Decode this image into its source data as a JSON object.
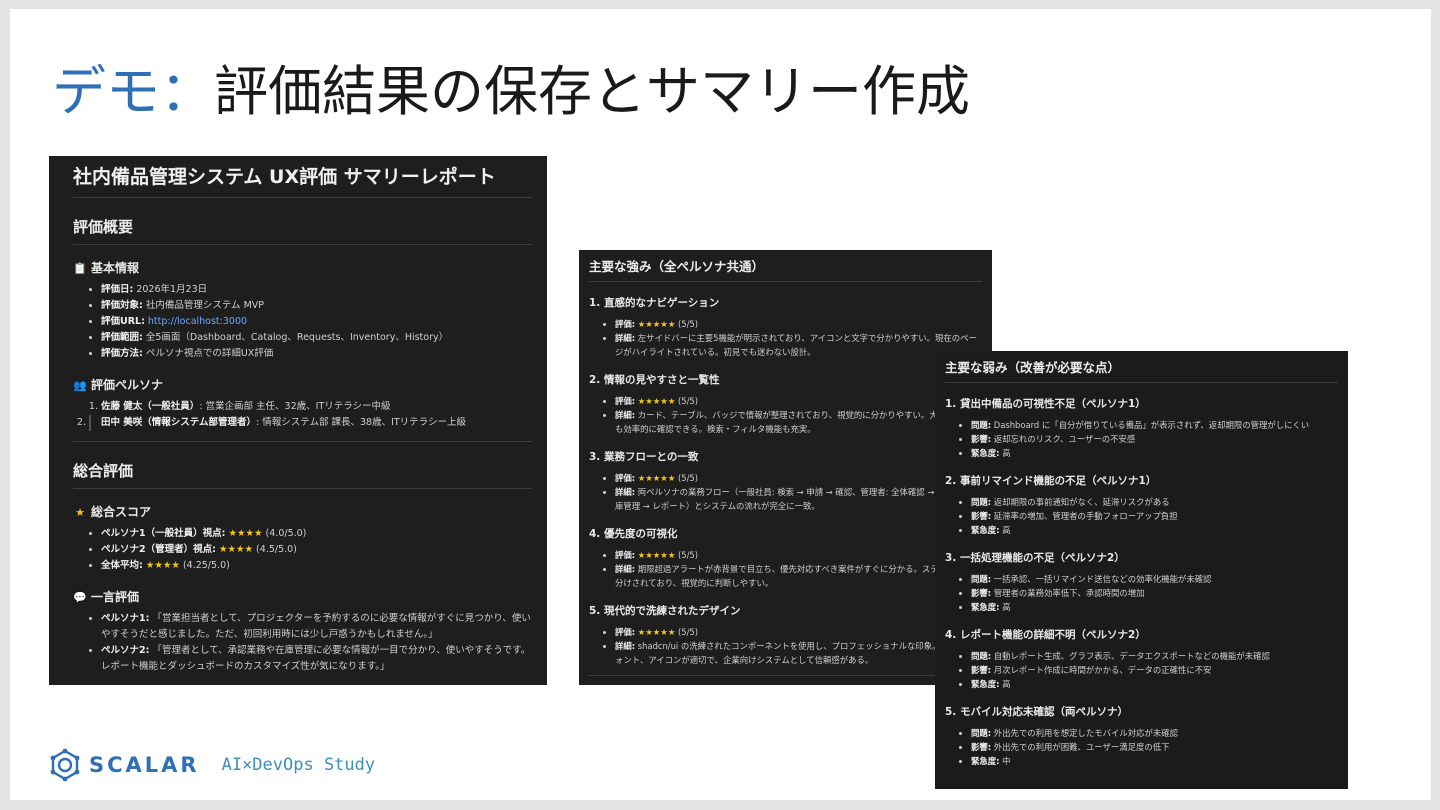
{
  "slide": {
    "title_accent": "デモ：",
    "title_rest": "評価結果の保存とサマリー作成"
  },
  "panel_summary": {
    "title": "社内備品管理システム UX評価 サマリーレポート",
    "overview_heading": "評価概要",
    "basic_info_heading": "基本情報",
    "basic_info": [
      {
        "label": "評価日:",
        "value": " 2026年1月23日"
      },
      {
        "label": "評価対象:",
        "value": " 社内備品管理システム MVP"
      },
      {
        "label": "評価URL:",
        "value": " http://localhost:3000"
      },
      {
        "label": "評価範囲:",
        "value": " 全5画面（Dashboard、Catalog、Requests、Inventory、History）"
      },
      {
        "label": "評価方法:",
        "value": " ペルソナ視点での詳細UX評価"
      }
    ],
    "persona_heading": "評価ペルソナ",
    "personas": [
      {
        "label": "佐藤 健太（一般社員）",
        "value": ": 営業企画部 主任、32歳、ITリテラシー中級"
      },
      {
        "label": "田中 美咲（情報システム部管理者）",
        "value": ": 情報システム部 課長、38歳、ITリテラシー上級"
      }
    ],
    "overall_heading": "総合評価",
    "score_heading": "総合スコア",
    "scores": [
      {
        "label": "ペルソナ1（一般社員）視点:",
        "stars": "★★★★",
        "value": " (4.0/5.0)"
      },
      {
        "label": "ペルソナ2（管理者）視点:",
        "stars": "★★★★",
        "value": " (4.5/5.0)"
      },
      {
        "label": "全体平均:",
        "stars": "★★★★",
        "value": " (4.25/5.0)"
      }
    ],
    "comment_heading": "一言評価",
    "comments": [
      {
        "label": "ペルソナ1:",
        "value": " 「営業担当者として、プロジェクターを予約するのに必要な情報がすぐに見つかり、使いやすそうだと感じました。ただ、初回利用時には少し戸惑うかもしれません。」"
      },
      {
        "label": "ペルソナ2:",
        "value": " 「管理者として、承認業務や在庫管理に必要な情報が一目で分かり、使いやすそうです。レポート機能とダッシュボードのカスタマイズ性が気になります。」"
      }
    ]
  },
  "panel_strengths": {
    "title": "主要な強み（全ペルソナ共通）",
    "items": [
      {
        "heading": "1. 直感的なナビゲーション",
        "rating_label": "評価:",
        "stars": "★★★★★",
        "rating": " (5/5)",
        "detail_label": "詳細:",
        "detail": " 左サイドバーに主要5機能が明示されており、アイコンと文字で分かりやすい。現在のページがハイライトされている。初見でも迷わない設計。"
      },
      {
        "heading": "2. 情報の見やすさと一覧性",
        "rating_label": "評価:",
        "stars": "★★★★★",
        "rating": " (5/5)",
        "detail_label": "詳細:",
        "detail": " カード、テーブル、バッジで情報が整理されており、視覚的に分かりやすい。大量のデータも効率的に確認できる。検索・フィルタ機能も充実。"
      },
      {
        "heading": "3. 業務フローとの一致",
        "rating_label": "評価:",
        "stars": "★★★★★",
        "rating": " (5/5)",
        "detail_label": "詳細:",
        "detail": " 両ペルソナの業務フロー（一般社員: 検索 → 申請 → 確認、管理者: 全体確認 → 承認 → 在庫管理 → レポート）とシステムの流れが完全に一致。"
      },
      {
        "heading": "4. 優先度の可視化",
        "rating_label": "評価:",
        "stars": "★★★★★",
        "rating": " (5/5)",
        "detail_label": "詳細:",
        "detail": " 期限超過アラートが赤背景で目立ち、優先対応すべき案件がすぐに分かる。ステータスが色分けされており、視覚的に判断しやすい。"
      },
      {
        "heading": "5. 現代的で洗練されたデザイン",
        "rating_label": "評価:",
        "stars": "★★★★★",
        "rating": " (5/5)",
        "detail_label": "詳細:",
        "detail": " shadcn/ui の洗練されたコンポーネントを使用し、プロフェッショナルな印象。配色、フォント、アイコンが適切で、企業向けシステムとして信頼感がある。"
      }
    ]
  },
  "panel_weaknesses": {
    "title": "主要な弱み（改善が必要な点）",
    "items": [
      {
        "heading": "1. 貸出中備品の可視性不足（ペルソナ1）",
        "rows": [
          {
            "label": "問題:",
            "value": " Dashboard に「自分が借りている備品」が表示されず、返却期限の管理がしにくい"
          },
          {
            "label": "影響:",
            "value": " 返却忘れのリスク、ユーザーの不安感"
          },
          {
            "label": "緊急度:",
            "value": " 高"
          }
        ]
      },
      {
        "heading": "2. 事前リマインド機能の不足（ペルソナ1）",
        "rows": [
          {
            "label": "問題:",
            "value": " 返却期限の事前通知がなく、延滞リスクがある"
          },
          {
            "label": "影響:",
            "value": " 延滞率の増加、管理者の手動フォローアップ負担"
          },
          {
            "label": "緊急度:",
            "value": " 高"
          }
        ]
      },
      {
        "heading": "3. 一括処理機能の不足（ペルソナ2）",
        "rows": [
          {
            "label": "問題:",
            "value": " 一括承認、一括リマインド送信などの効率化機能が未確認"
          },
          {
            "label": "影響:",
            "value": " 管理者の業務効率低下、承認時間の増加"
          },
          {
            "label": "緊急度:",
            "value": " 高"
          }
        ]
      },
      {
        "heading": "4. レポート機能の詳細不明（ペルソナ2）",
        "rows": [
          {
            "label": "問題:",
            "value": " 自動レポート生成、グラフ表示、データエクスポートなどの機能が未確認"
          },
          {
            "label": "影響:",
            "value": " 月次レポート作成に時間がかかる、データの正確性に不安"
          },
          {
            "label": "緊急度:",
            "value": " 高"
          }
        ]
      },
      {
        "heading": "5. モバイル対応未確認（両ペルソナ）",
        "rows": [
          {
            "label": "問題:",
            "value": " 外出先での利用を想定したモバイル対応が未確認"
          },
          {
            "label": "影響:",
            "value": " 外出先での利用が困難、ユーザー満足度の低下"
          },
          {
            "label": "緊急度:",
            "value": " 中"
          }
        ]
      }
    ]
  },
  "footer": {
    "logo_text": "SCALAR",
    "tagline": "AI×DevOps Study"
  },
  "icons": [
    "clipboard-icon",
    "people-icon",
    "star-icon",
    "speech-bubble-icon",
    "scalar-logo-icon"
  ],
  "colors": {
    "accent": "#2f6fb6",
    "panel_bg": "#1e1e1e",
    "star": "#f5c518",
    "link": "#6ea8ff"
  }
}
